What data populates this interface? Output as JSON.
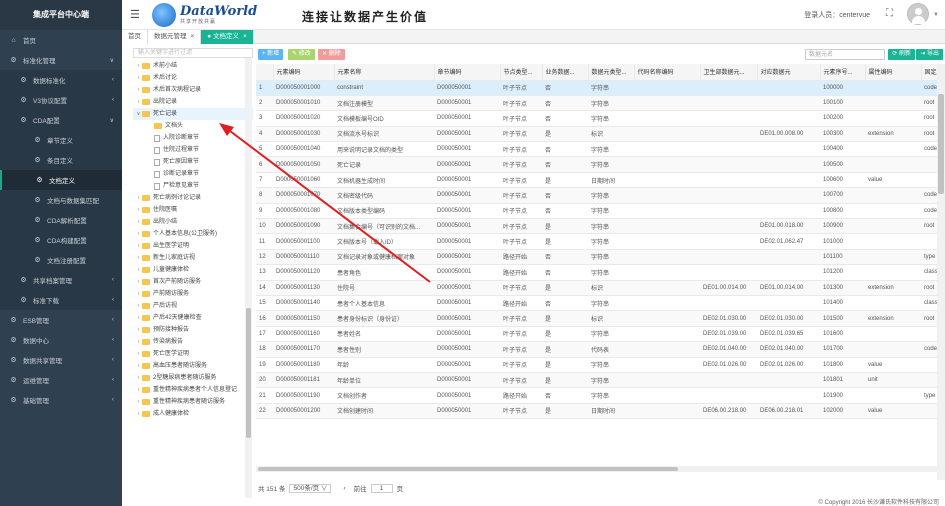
{
  "app": {
    "title": "集成平台中心端"
  },
  "sidebar": {
    "items": [
      {
        "label": "首页",
        "icon": "home-icon",
        "level": 0
      },
      {
        "label": "标准化管理",
        "icon": "gear-icon",
        "level": 0,
        "arrow": "∨"
      },
      {
        "label": "数据标准化",
        "icon": "gear-icon",
        "level": 1,
        "arrow": "‹"
      },
      {
        "label": "V3协议配置",
        "icon": "gear-icon",
        "level": 1,
        "arrow": "‹"
      },
      {
        "label": "CDA配置",
        "icon": "gear-icon",
        "level": 1,
        "arrow": "∨"
      },
      {
        "label": "章节定义",
        "icon": "gear-icon",
        "level": 2
      },
      {
        "label": "条目定义",
        "icon": "gear-icon",
        "level": 2
      },
      {
        "label": "文档定义",
        "icon": "gear-icon",
        "level": 2,
        "active": true
      },
      {
        "label": "文档与数据集匹配",
        "icon": "gear-icon",
        "level": 2
      },
      {
        "label": "CDA解析配置",
        "icon": "gear-icon",
        "level": 2
      },
      {
        "label": "CDA构建配置",
        "icon": "gear-icon",
        "level": 2
      },
      {
        "label": "文档注册配置",
        "icon": "gear-icon",
        "level": 2
      },
      {
        "label": "共享档案管理",
        "icon": "gear-icon",
        "level": 1,
        "arrow": "‹"
      },
      {
        "label": "标准下载",
        "icon": "gear-icon",
        "level": 1,
        "arrow": "‹"
      },
      {
        "label": "ESB管理",
        "icon": "gear-icon",
        "level": 0,
        "arrow": "‹"
      },
      {
        "label": "数据中心",
        "icon": "gear-icon",
        "level": 0,
        "arrow": "‹"
      },
      {
        "label": "数据共享管理",
        "icon": "gear-icon",
        "level": 0,
        "arrow": "‹"
      },
      {
        "label": "运维管理",
        "icon": "gear-icon",
        "level": 0,
        "arrow": "‹"
      },
      {
        "label": "基础管理",
        "icon": "gear-icon",
        "level": 0,
        "arrow": "‹"
      }
    ]
  },
  "header": {
    "logo_text": "DataWorld",
    "logo_sub": "共享开放共赢",
    "slogan": "连接让数据产生价值",
    "login_label": "登录人员：centervue"
  },
  "tabs": [
    {
      "label": "首页",
      "active": false
    },
    {
      "label": "数据元管理",
      "active": false,
      "close": "×"
    },
    {
      "label": "● 文档定义",
      "active": true,
      "close": "×"
    }
  ],
  "tree": {
    "search_placeholder": "输入关键字进行过滤",
    "nodes": [
      {
        "label": "术前小结",
        "toggle": "›",
        "type": "folder",
        "level": 0
      },
      {
        "label": "术后讨论",
        "toggle": "›",
        "type": "folder",
        "level": 0
      },
      {
        "label": "术后首次病程记录",
        "toggle": "›",
        "type": "folder",
        "level": 0
      },
      {
        "label": "出院记录",
        "toggle": "›",
        "type": "folder",
        "level": 0
      },
      {
        "label": "死亡记录",
        "toggle": "∨",
        "type": "folder",
        "level": 0,
        "selected": true
      },
      {
        "label": "文档头",
        "toggle": "",
        "type": "folder",
        "level": 1
      },
      {
        "label": "入院诊断章节",
        "toggle": "",
        "type": "file",
        "level": 1
      },
      {
        "label": "住院过程章节",
        "toggle": "",
        "type": "file",
        "level": 1
      },
      {
        "label": "死亡原因章节",
        "toggle": "",
        "type": "file",
        "level": 1
      },
      {
        "label": "诊断记录章节",
        "toggle": "",
        "type": "file",
        "level": 1
      },
      {
        "label": "尸检意见章节",
        "toggle": "",
        "type": "file",
        "level": 1
      },
      {
        "label": "死亡病例讨论记录",
        "toggle": "›",
        "type": "folder",
        "level": 0
      },
      {
        "label": "住院医嘱",
        "toggle": "›",
        "type": "folder",
        "level": 0
      },
      {
        "label": "出院小结",
        "toggle": "›",
        "type": "folder",
        "level": 0
      },
      {
        "label": "个人基本信息(公卫服务)",
        "toggle": "›",
        "type": "folder",
        "level": 0
      },
      {
        "label": "出生医学证明",
        "toggle": "›",
        "type": "folder",
        "level": 0
      },
      {
        "label": "新生儿家庭访视",
        "toggle": "›",
        "type": "folder",
        "level": 0
      },
      {
        "label": "儿童健康体检",
        "toggle": "›",
        "type": "folder",
        "level": 0
      },
      {
        "label": "首次产前随访服务",
        "toggle": "›",
        "type": "folder",
        "level": 0
      },
      {
        "label": "产前随访服务",
        "toggle": "›",
        "type": "folder",
        "level": 0
      },
      {
        "label": "产后访视",
        "toggle": "›",
        "type": "folder",
        "level": 0
      },
      {
        "label": "产后42天健康检查",
        "toggle": "›",
        "type": "folder",
        "level": 0
      },
      {
        "label": "预防接种报告",
        "toggle": "›",
        "type": "folder",
        "level": 0
      },
      {
        "label": "传染病报告",
        "toggle": "›",
        "type": "folder",
        "level": 0
      },
      {
        "label": "死亡医学证明",
        "toggle": "›",
        "type": "folder",
        "level": 0
      },
      {
        "label": "高血压患者随访服务",
        "toggle": "›",
        "type": "folder",
        "level": 0
      },
      {
        "label": "2型糖尿病患者随访服务",
        "toggle": "›",
        "type": "folder",
        "level": 0
      },
      {
        "label": "重性精神疾病患者个人信息登记",
        "toggle": "›",
        "type": "folder",
        "level": 0
      },
      {
        "label": "重性精神疾病患者随访服务",
        "toggle": "›",
        "type": "folder",
        "level": 0
      },
      {
        "label": "成人健康体检",
        "toggle": "›",
        "type": "folder",
        "level": 0
      }
    ]
  },
  "toolbar": {
    "add": "+ 新增",
    "edit": "✎ 修改",
    "delete": "✕ 删除",
    "search_placeholder": "数据元名",
    "refresh": "⟳ 刷新",
    "export": "⇥ 导出",
    "colors": {
      "add": "#5bb6f0",
      "edit": "#a9d46e",
      "delete": "#f29b9b",
      "refresh": "#1ab394",
      "export": "#1ab394"
    }
  },
  "table": {
    "headers": [
      "",
      "元素编码",
      "元素名称",
      "章节编码",
      "节点类型...",
      "业务数据...",
      "数据元类型...",
      "代码名称编码",
      "卫生部数据元...",
      "对应数据元",
      "元素序号...",
      "属性编码",
      "固定属性"
    ],
    "rows": [
      [
        "1",
        "D000050001000",
        "constraint",
        "D000050001",
        "叶子节点",
        "否",
        "字符串",
        "",
        "",
        "",
        "100000",
        "",
        "code"
      ],
      [
        "2",
        "D000050001010",
        "文档注册模型",
        "D000050001",
        "叶子节点",
        "否",
        "字符串",
        "",
        "",
        "",
        "100100",
        "",
        "root"
      ],
      [
        "3",
        "D000050001020",
        "文档模板编号OID",
        "D000050001",
        "叶子节点",
        "否",
        "字符串",
        "",
        "",
        "",
        "100200",
        "",
        "root"
      ],
      [
        "4",
        "D000050001030",
        "文档流水号标识",
        "D000050001",
        "叶子节点",
        "是",
        "标识",
        "",
        "",
        "DE01.00.008.00",
        "100300",
        "extension",
        "root"
      ],
      [
        "5",
        "D000050001040",
        "用来说明记录文档的类型",
        "D000050001",
        "叶子节点",
        "否",
        "字符串",
        "",
        "",
        "",
        "100400",
        "",
        "code"
      ],
      [
        "6",
        "D000050001050",
        "死亡记录",
        "D000050001",
        "叶子节点",
        "否",
        "字符串",
        "",
        "",
        "",
        "100500",
        "",
        ""
      ],
      [
        "7",
        "D000050001060",
        "文档机器生成时间",
        "D000050001",
        "叶子节点",
        "是",
        "日期时间",
        "",
        "",
        "",
        "100600",
        "value",
        ""
      ],
      [
        "8",
        "D000050001070",
        "文档密级代码",
        "D000050001",
        "叶子节点",
        "否",
        "字符串",
        "",
        "",
        "",
        "100700",
        "",
        "code"
      ],
      [
        "9",
        "D000050001080",
        "文档版本类型编码",
        "D000050001",
        "叶子节点",
        "否",
        "字符串",
        "",
        "",
        "",
        "100800",
        "",
        "code"
      ],
      [
        "10",
        "D000050001090",
        "文档集合编号（可识别的文档...",
        "D000050001",
        "叶子节点",
        "是",
        "字符串",
        "",
        "",
        "DE01.00.018.00",
        "100900",
        "",
        "root"
      ],
      [
        "11",
        "D000050001100",
        "文档版本号（载入ID）",
        "D000050001",
        "叶子节点",
        "是",
        "字符串",
        "",
        "",
        "DE02.01.062.47",
        "101000",
        "",
        ""
      ],
      [
        "12",
        "D000050001110",
        "文档记录对象或健康档案对象",
        "D000050001",
        "路径开始",
        "否",
        "字符串",
        "",
        "",
        "",
        "101100",
        "",
        "type"
      ],
      [
        "13",
        "D000050001120",
        "患者角色",
        "D000050001",
        "路径开始",
        "否",
        "字符串",
        "",
        "",
        "",
        "101200",
        "",
        "class"
      ],
      [
        "14",
        "D000050001130",
        "住院号",
        "D000050001",
        "叶子节点",
        "是",
        "标识",
        "",
        "DE01.00.014.00",
        "DE01.00.014.00",
        "101300",
        "extension",
        "root"
      ],
      [
        "15",
        "D000050001140",
        "患者个人基本信息",
        "D000050001",
        "路径开始",
        "否",
        "字符串",
        "",
        "",
        "",
        "101400",
        "",
        "class"
      ],
      [
        "16",
        "D000050001150",
        "患者身份标识（身份证）",
        "D000050001",
        "叶子节点",
        "是",
        "标识",
        "",
        "DE02.01.030.00",
        "DE02.01.030.00",
        "101500",
        "extension",
        "root"
      ],
      [
        "17",
        "D000050001160",
        "患者姓名",
        "D000050001",
        "叶子节点",
        "是",
        "字符串",
        "",
        "DE02.01.039.00",
        "DE02.01.039.65",
        "101600",
        "",
        ""
      ],
      [
        "18",
        "D000050001170",
        "患者性别",
        "D000050001",
        "叶子节点",
        "是",
        "代码表",
        "",
        "DE02.01.040.00",
        "DE02.01.040.00",
        "101700",
        "",
        "code"
      ],
      [
        "19",
        "D000050001180",
        "年龄",
        "D000050001",
        "叶子节点",
        "是",
        "字符串",
        "",
        "DE02.01.026.00",
        "DE02.01.026.00",
        "101800",
        "value",
        ""
      ],
      [
        "20",
        "D000050001181",
        "年龄单位",
        "D000050001",
        "叶子节点",
        "是",
        "字符串",
        "",
        "",
        "",
        "101801",
        "unit",
        ""
      ],
      [
        "21",
        "D000050001190",
        "文档创作者",
        "D000050001",
        "路径开始",
        "否",
        "字符串",
        "",
        "",
        "",
        "101900",
        "",
        "type"
      ],
      [
        "22",
        "D000050001200",
        "文档创建时间",
        "D000050001",
        "叶子节点",
        "是",
        "日期时间",
        "",
        "DE06.00.218.00",
        "DE06.00.218.01",
        "102000",
        "value",
        ""
      ]
    ]
  },
  "pager": {
    "total": "共 151 条",
    "page_size": "500条/页 ∨",
    "prev": "‹",
    "goto_label": "前往",
    "page": "1",
    "page_suffix": "页"
  },
  "footer": {
    "copyright": "© Copyright 2016 长沙谦氏软件科技有限公司"
  }
}
